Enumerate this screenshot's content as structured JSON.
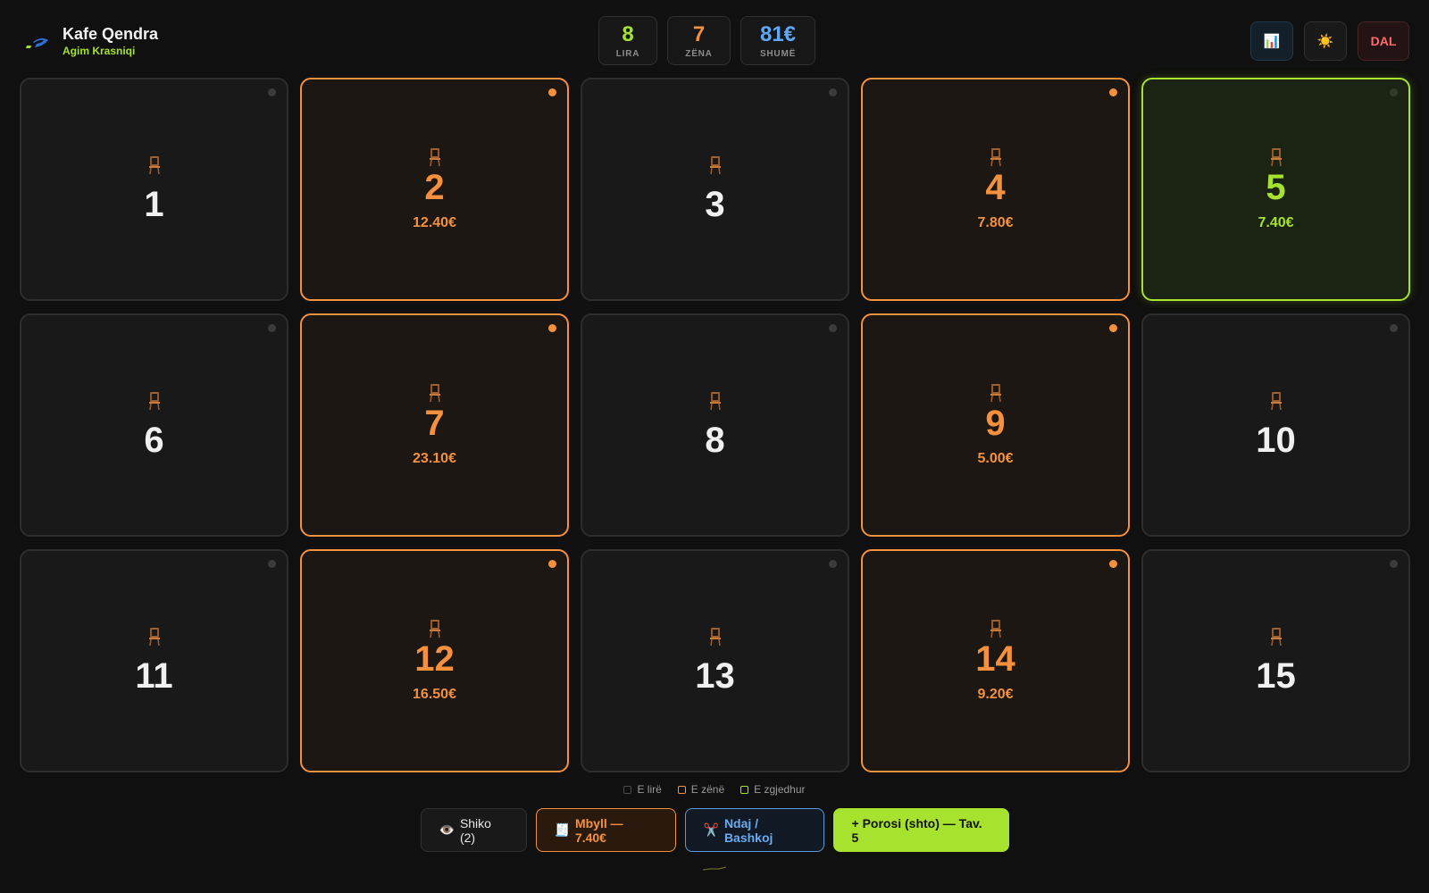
{
  "brand": {
    "name": "Kafe Qendra",
    "user": "Agim Krasniqi"
  },
  "stats": [
    {
      "value": "8",
      "label": "LIRA",
      "color": "#a6e22e"
    },
    {
      "value": "7",
      "label": "ZËNA",
      "color": "#f5913e"
    },
    {
      "value": "81€",
      "label": "SHUMË",
      "color": "#5ea8f5"
    }
  ],
  "actions": {
    "stats_icon": "📊",
    "theme_icon": "☀️",
    "exit_label": "DAL"
  },
  "tables": [
    {
      "number": "1",
      "status": "free",
      "amount": ""
    },
    {
      "number": "2",
      "status": "busy",
      "amount": "12.40€"
    },
    {
      "number": "3",
      "status": "free",
      "amount": ""
    },
    {
      "number": "4",
      "status": "busy",
      "amount": "7.80€"
    },
    {
      "number": "5",
      "status": "selected",
      "amount": "7.40€"
    },
    {
      "number": "6",
      "status": "free",
      "amount": ""
    },
    {
      "number": "7",
      "status": "busy",
      "amount": "23.10€"
    },
    {
      "number": "8",
      "status": "free",
      "amount": ""
    },
    {
      "number": "9",
      "status": "busy",
      "amount": "5.00€"
    },
    {
      "number": "10",
      "status": "free",
      "amount": ""
    },
    {
      "number": "11",
      "status": "free",
      "amount": ""
    },
    {
      "number": "12",
      "status": "busy",
      "amount": "16.50€"
    },
    {
      "number": "13",
      "status": "free",
      "amount": ""
    },
    {
      "number": "14",
      "status": "busy",
      "amount": "9.20€"
    },
    {
      "number": "15",
      "status": "free",
      "amount": ""
    }
  ],
  "legend": [
    {
      "label": "E lirë",
      "color": "#4a4b4a"
    },
    {
      "label": "E zënë",
      "color": "#f5913e"
    },
    {
      "label": "E zgjedhur",
      "color": "#a6e22e"
    }
  ],
  "buttons": {
    "view": {
      "icon": "👁️",
      "label": "Shiko (2)"
    },
    "close": {
      "icon": "🧾",
      "label": "Mbyll — 7.40€"
    },
    "split": {
      "icon": "✂️",
      "label": "Ndaj / Bashkoj"
    },
    "order": {
      "label": "+ Porosi (shto) — Tav. 5"
    }
  }
}
